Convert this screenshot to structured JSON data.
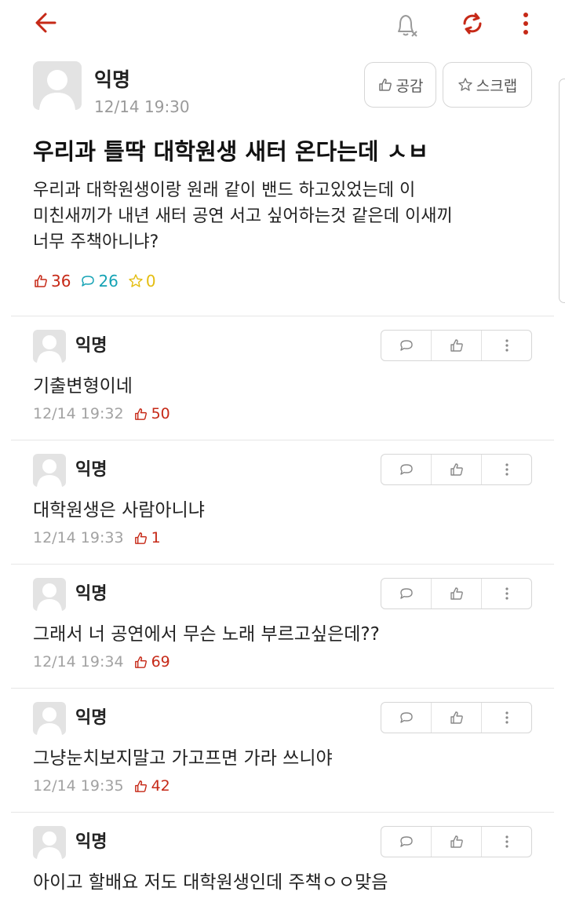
{
  "colors": {
    "accent": "#c62917",
    "comment": "#16a3b5",
    "scrap": "#e4bd10",
    "muted": "#9a9a9a"
  },
  "toolbar": {
    "back_icon": "arrow-left-icon",
    "bell_icon": "bell-off-icon",
    "refresh_icon": "refresh-icon",
    "more_icon": "more-vertical-icon"
  },
  "post": {
    "author": "익명",
    "time": "12/14 19:30",
    "like_button": "공감",
    "scrap_button": "스크랩",
    "title": "우리과 틀딱 대학원생 새터 온다는데 ㅅㅂ",
    "body": "우리과 대학원생이랑 원래 같이 밴드 하고있었는데 이\n미친새끼가 내년 새터 공연 서고 싶어하는것 같은데 이새끼\n너무 주책아니냐?",
    "likes": "36",
    "comments": "26",
    "scraps": "0"
  },
  "comments": [
    {
      "author": "익명",
      "text": "기출변형이네",
      "time": "12/14 19:32",
      "likes": "50"
    },
    {
      "author": "익명",
      "text": "대학원생은 사람아니냐",
      "time": "12/14 19:33",
      "likes": "1"
    },
    {
      "author": "익명",
      "text": "그래서 너 공연에서 무슨 노래 부르고싶은데??",
      "time": "12/14 19:34",
      "likes": "69"
    },
    {
      "author": "익명",
      "text": "그냥눈치보지말고 가고프면 가라 쓰니야",
      "time": "12/14 19:35",
      "likes": "42"
    },
    {
      "author": "익명",
      "text": "아이고 할배요 저도 대학원생인데 주책ㅇㅇ맞음",
      "time": "",
      "likes": ""
    }
  ]
}
